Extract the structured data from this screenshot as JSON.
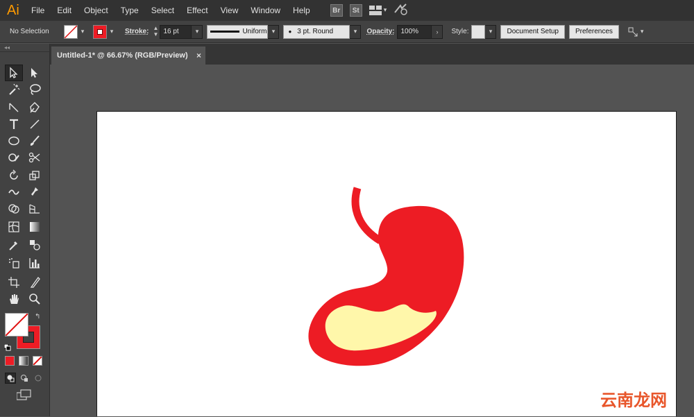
{
  "app": {
    "logo_text": "Ai"
  },
  "menu": [
    "File",
    "Edit",
    "Object",
    "Type",
    "Select",
    "Effect",
    "View",
    "Window",
    "Help"
  ],
  "menu_bar_apps": [
    "Br",
    "St"
  ],
  "control_bar": {
    "selection_status": "No Selection",
    "stroke_label": "Stroke:",
    "stroke_weight": "16 pt",
    "variable_width_profile": "Uniform",
    "brush": "3 pt. Round",
    "opacity_label": "Opacity:",
    "opacity_value": "100%",
    "style_label": "Style:",
    "document_setup_label": "Document Setup",
    "preferences_label": "Preferences"
  },
  "document_tab": {
    "title": "Untitled-1* @ 66.67% (RGB/Preview)",
    "close_glyph": "×"
  },
  "colors": {
    "stroke_red": "#ee1c25",
    "stomach_red": "#ed1c24",
    "inner_cream": "#fff7aa",
    "accent_orange": "#ff9a00"
  },
  "watermark": {
    "text": "云南龙网"
  }
}
